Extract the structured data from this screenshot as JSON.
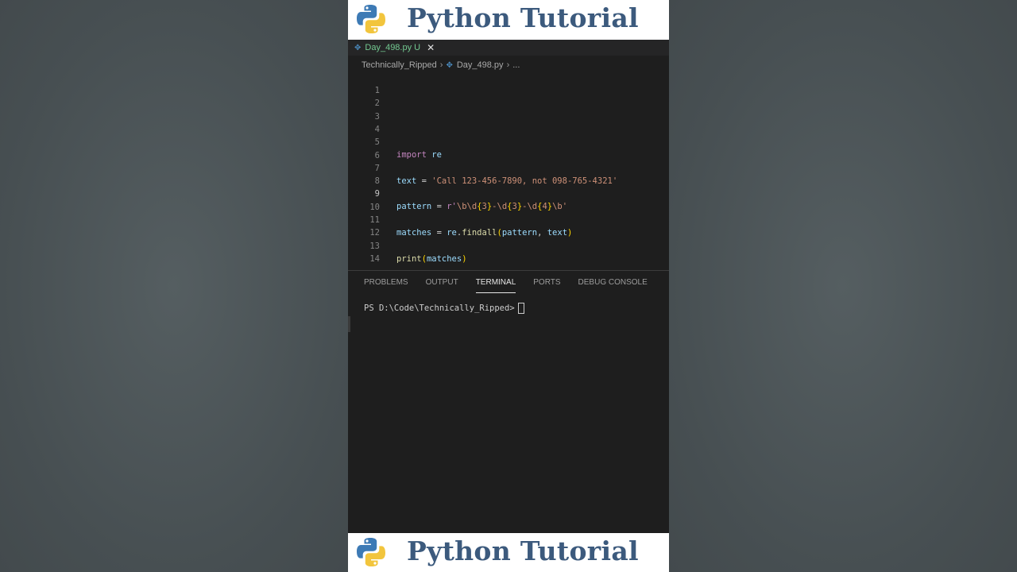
{
  "banner": {
    "title": "Python Tutorial"
  },
  "tab": {
    "filename": "Day_498.py",
    "status": "U"
  },
  "breadcrumb": {
    "folder": "Technically_Ripped",
    "file": "Day_498.py",
    "more": "..."
  },
  "editor": {
    "line_numbers": [
      "1",
      "2",
      "3",
      "4",
      "5",
      "6",
      "7",
      "8",
      "9",
      "10",
      "11",
      "12",
      "13",
      "14"
    ],
    "active_line": "9"
  },
  "code": {
    "l5": {
      "kw": "import",
      "mod": "re"
    },
    "l7": {
      "var": "text",
      "op": " = ",
      "str": "'Call 123-456-7890, not 098-765-4321'"
    },
    "l9": {
      "var": "pattern",
      "op": " = ",
      "prefix": "r'",
      "esc1": "\\b\\d",
      "b1o": "{",
      "n1": "3",
      "b1c": "}",
      "dash1": "-",
      "esc2": "\\d",
      "b2o": "{",
      "n2": "3",
      "b2c": "}",
      "dash2": "-",
      "esc3": "\\d",
      "b3o": "{",
      "n3": "4",
      "b3c": "}",
      "esc4": "\\b",
      "suffix": "'"
    },
    "l11": {
      "var": "matches",
      "op": " = ",
      "mod": "re",
      "dot": ".",
      "fn": "findall",
      "po": "(",
      "a1": "pattern",
      "comma": ", ",
      "a2": "text",
      "pc": ")"
    },
    "l13": {
      "fn": "print",
      "po": "(",
      "arg": "matches",
      "pc": ")"
    }
  },
  "panel": {
    "tabs": [
      "PROBLEMS",
      "OUTPUT",
      "TERMINAL",
      "PORTS",
      "DEBUG CONSOLE"
    ],
    "active_tab": "TERMINAL",
    "prompt": "PS D:\\Code\\Technically_Ripped>"
  },
  "colors": {
    "keyword": "#c586c0",
    "variable": "#9cdcfe",
    "string": "#ce9178",
    "function": "#dcdcaa",
    "banner_text": "#3c5a7d"
  }
}
